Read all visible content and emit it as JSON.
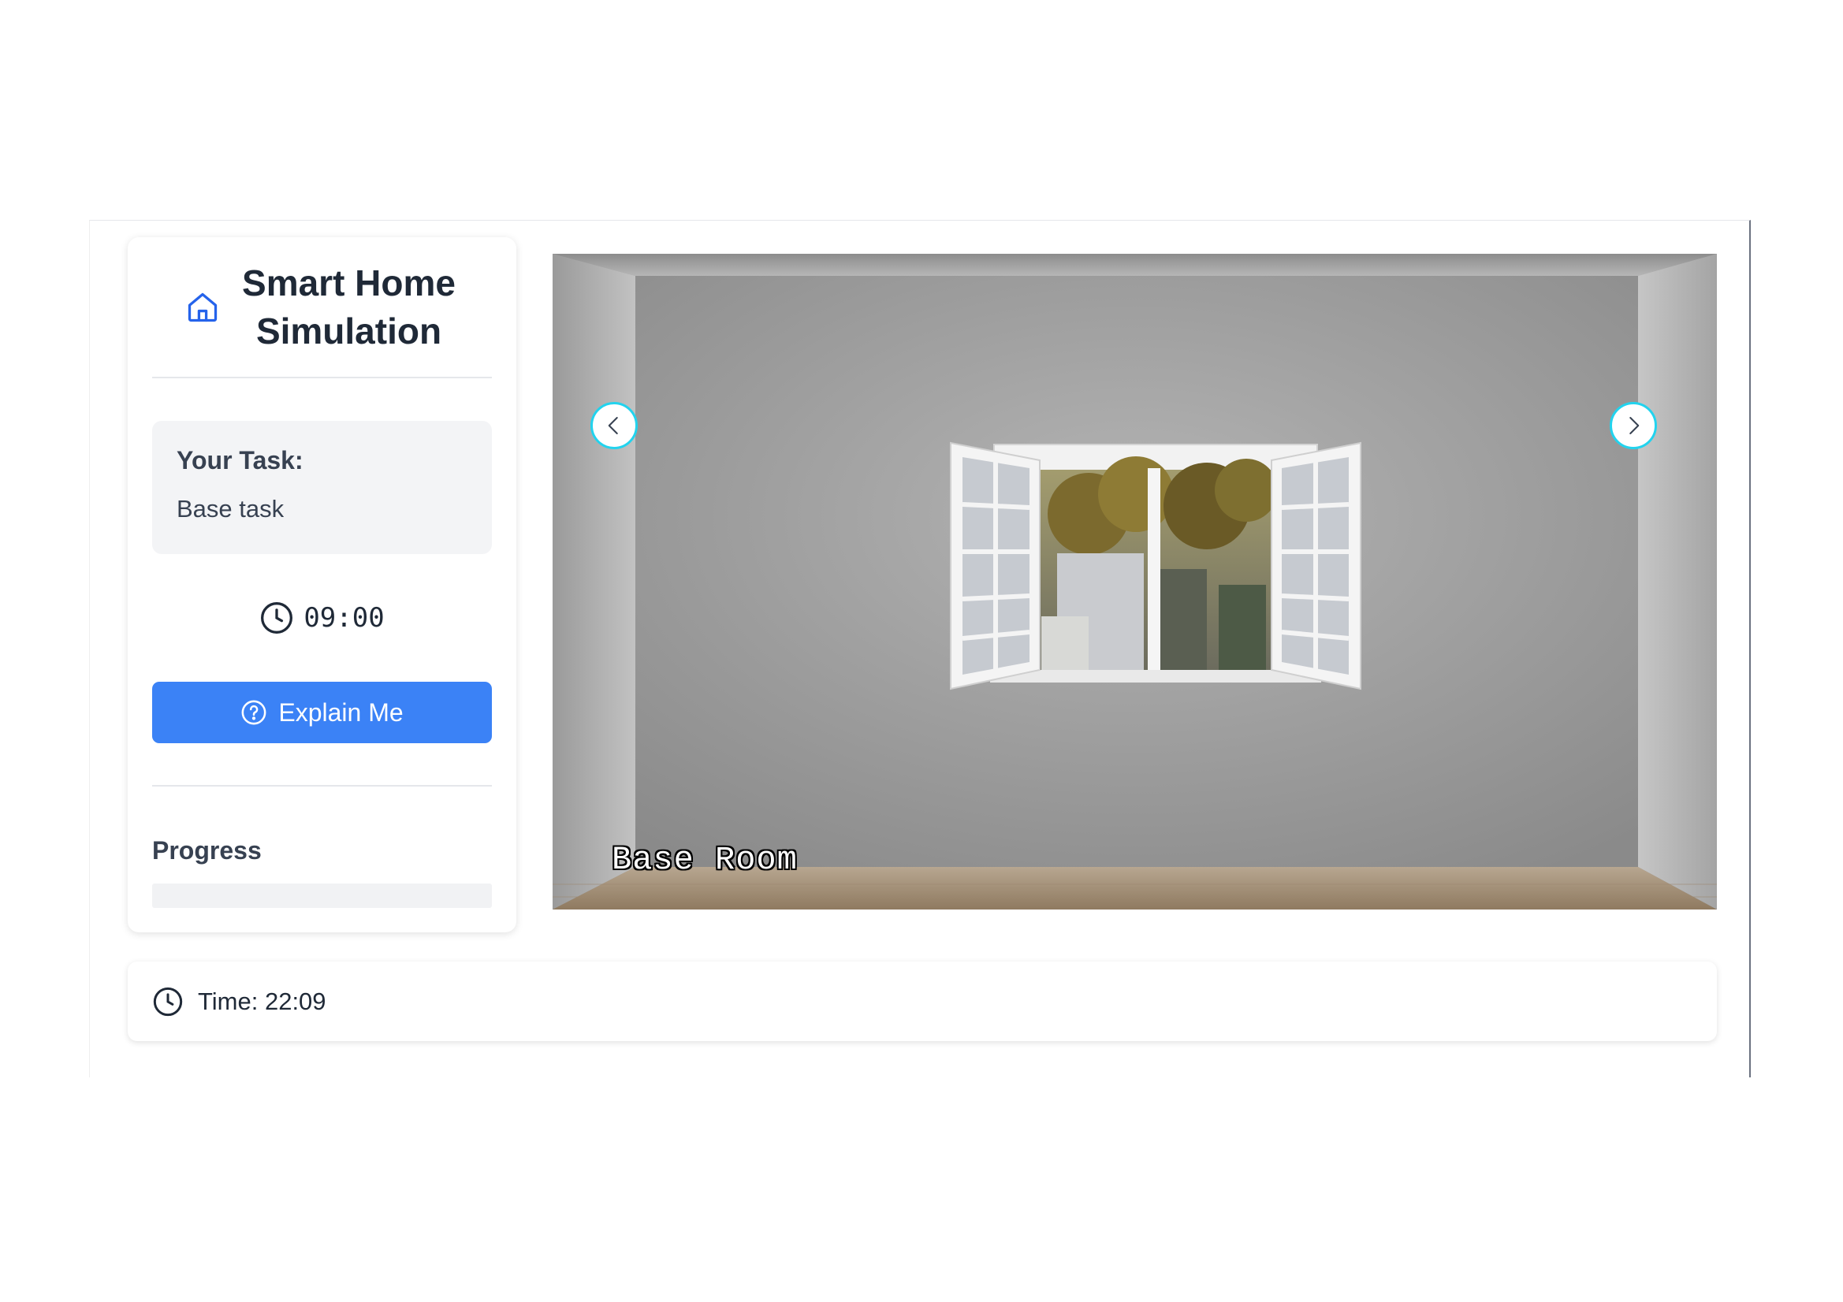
{
  "sidebar": {
    "title": "Smart Home Simulation",
    "title_icon": "home-icon",
    "task": {
      "heading": "Your Task:",
      "text": "Base task"
    },
    "timer": {
      "icon": "clock-icon",
      "value": "09:00"
    },
    "explain_button": {
      "label": "Explain Me",
      "icon": "help-circle-icon"
    },
    "progress": {
      "label": "Progress",
      "fraction": 0
    }
  },
  "room": {
    "name": "Base Room",
    "prev_icon": "chevron-left-icon",
    "next_icon": "chevron-right-icon"
  },
  "status_bar": {
    "icon": "clock-icon",
    "time_text": "Time: 22:09"
  },
  "colors": {
    "accent": "#3b82f6",
    "nav_ring": "#22d3ee",
    "wall": "#8f8f8f",
    "floor": "#a08a70"
  }
}
